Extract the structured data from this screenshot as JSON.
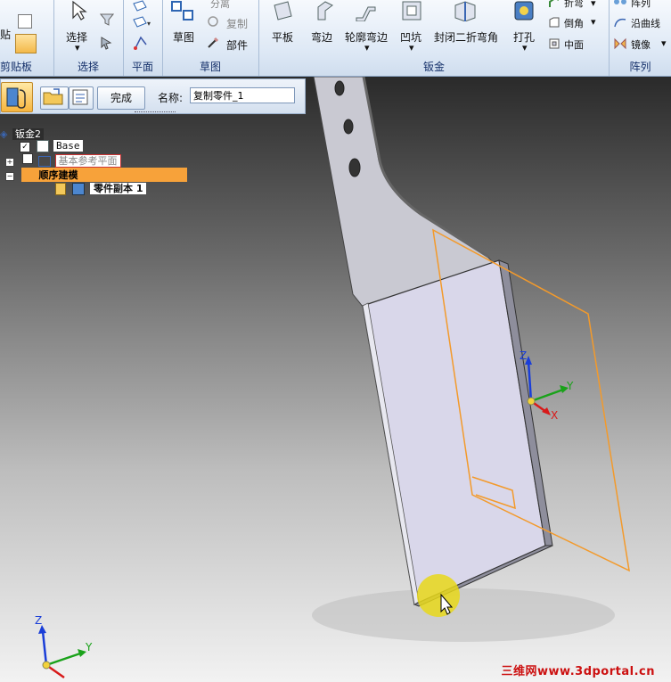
{
  "ribbon": {
    "groups": {
      "clipboard": "剪贴板",
      "select": "选择",
      "plane": "平面",
      "sketch": "草图",
      "sheetmetal": "钣金",
      "pattern": "阵列"
    },
    "clipboard_paste_label": "贴",
    "select_label": "选择",
    "sketch_label": "草图",
    "separate_label": "分离",
    "copy_label": "复制",
    "part_label": "部件",
    "flat_label": "平板",
    "flange_label": "弯边",
    "contour_flange_label": "轮廓弯边",
    "dimple_label": "凹坑",
    "closed_corner_label": "封闭二折弯角",
    "punch_label": "打孔",
    "bend_label": "折弯",
    "chamfer_label": "倒角",
    "midplane_label": "中面",
    "pattern_label": "阵列",
    "along_curve_label": "沿曲线",
    "mirror_label": "镜像"
  },
  "command_bar": {
    "finish_label": "完成",
    "name_label": "名称:",
    "name_value": "复制零件_1"
  },
  "tree": {
    "root": "钣金2",
    "base": "Base",
    "ref_planes": "基本参考平面",
    "ordered": "顺序建模",
    "part_copy": "零件副本 1"
  },
  "triad_labels": {
    "x": "X",
    "y": "Y",
    "z": "Z"
  },
  "watermark": "三维网www.3dportal.cn",
  "colors": {
    "part_fill": "#d9d7ea",
    "selection_orange": "#f39a2b",
    "ordered_highlight": "#f7a23a"
  }
}
